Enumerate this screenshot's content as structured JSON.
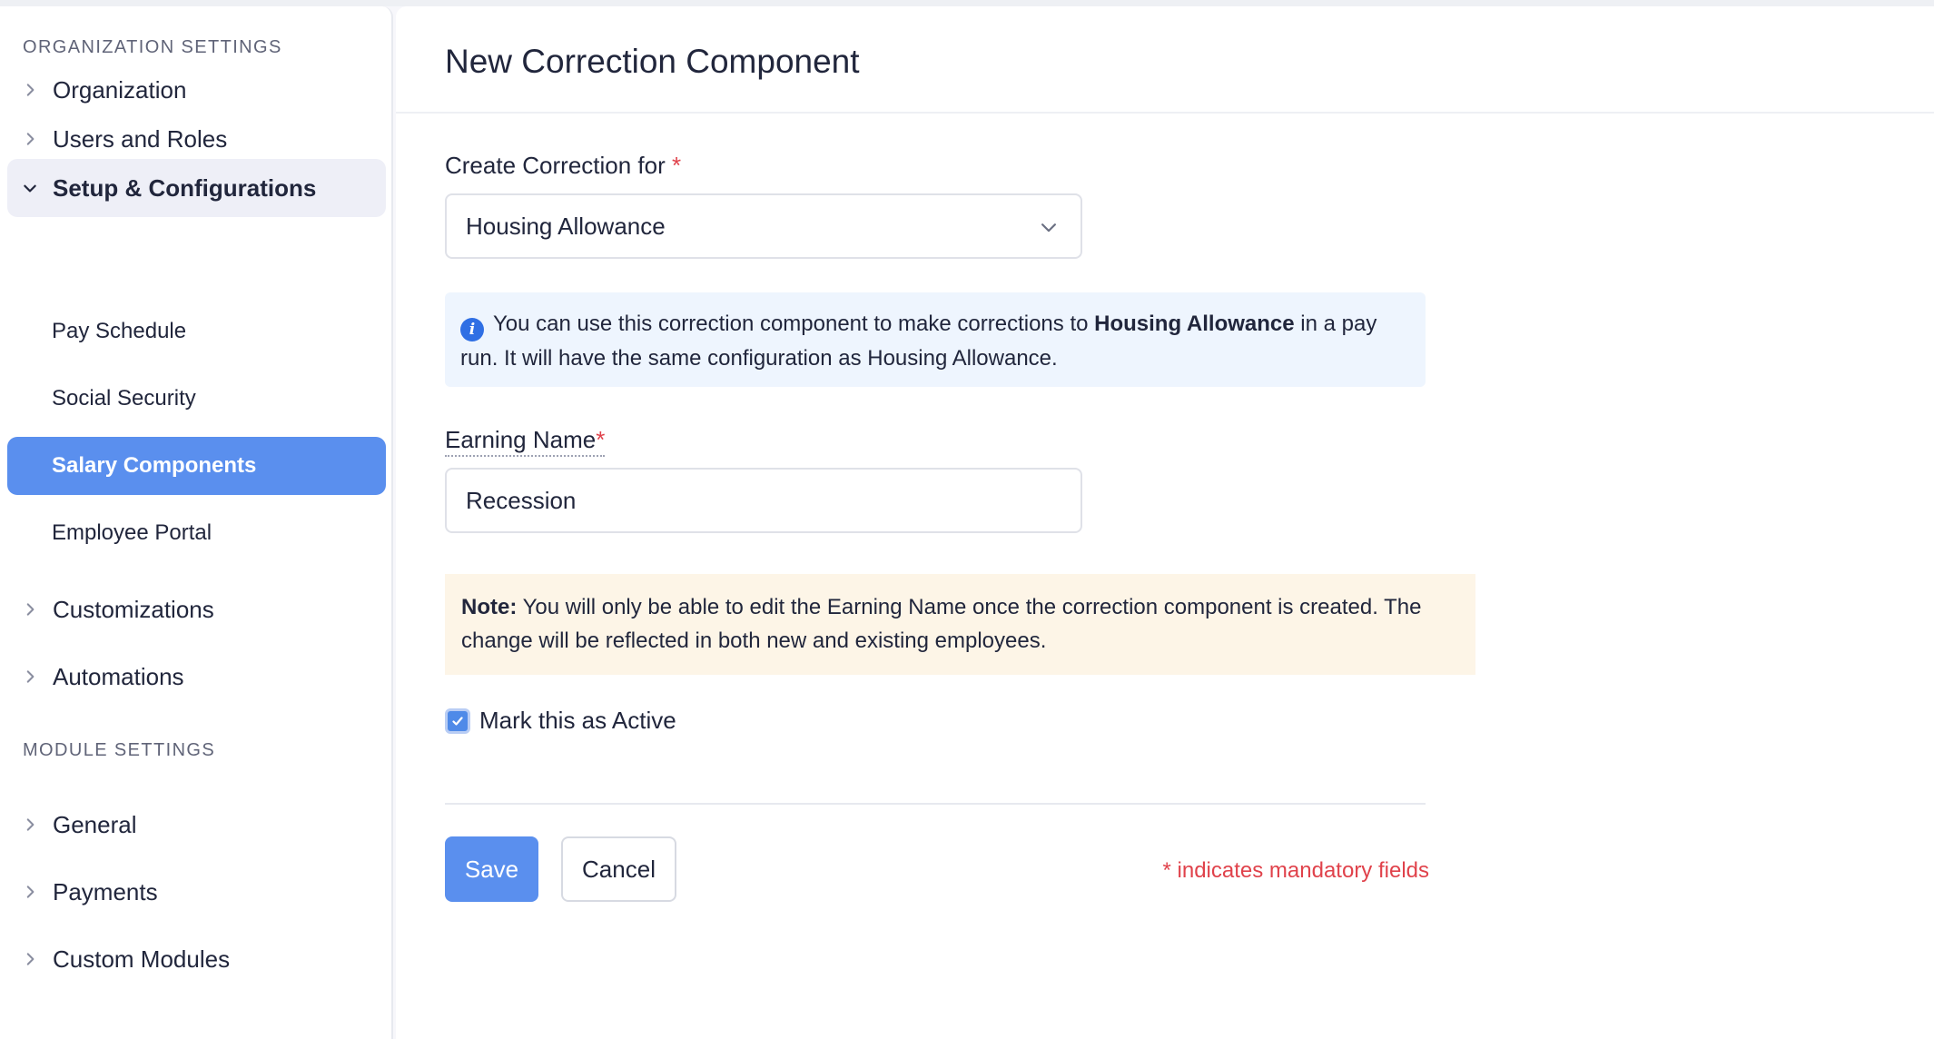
{
  "sidebar": {
    "org_section_title": "ORGANIZATION SETTINGS",
    "module_section_title": "MODULE SETTINGS",
    "org_items": [
      {
        "label": "Organization"
      },
      {
        "label": "Users and Roles"
      },
      {
        "label": "Setup & Configurations"
      }
    ],
    "sub_items": [
      {
        "label": "Pay Schedule"
      },
      {
        "label": "Social Security"
      },
      {
        "label": "Salary Components"
      },
      {
        "label": "Employee Portal"
      }
    ],
    "more_items": [
      {
        "label": "Customizations"
      },
      {
        "label": "Automations"
      }
    ],
    "module_items": [
      {
        "label": "General"
      },
      {
        "label": "Payments"
      },
      {
        "label": "Custom Modules"
      }
    ]
  },
  "main": {
    "title": "New Correction Component",
    "create_for_label": "Create Correction for",
    "required_mark": "*",
    "create_for_value": "Housing Allowance",
    "info": {
      "text_before": "You can use this correction component to make corrections to",
      "highlight": "Housing Allowance",
      "text_after": "in a pay run. It will have the same configuration as Housing Allowance."
    },
    "earning_name_label": "Earning Name",
    "earning_name_value": "Recession",
    "note": {
      "prefix": "Note:",
      "text": "You will only be able to edit the Earning Name once the correction component is created. The change will be reflected in both new and existing employees."
    },
    "active_checkbox": {
      "label": "Mark this as Active",
      "checked": true
    },
    "save_label": "Save",
    "cancel_label": "Cancel",
    "mandatory_note": "* indicates mandatory fields"
  },
  "colors": {
    "accent": "#5a8fee",
    "required": "#e0424b",
    "info_bg": "#eef5fe",
    "note_bg": "#fdf5e7"
  }
}
